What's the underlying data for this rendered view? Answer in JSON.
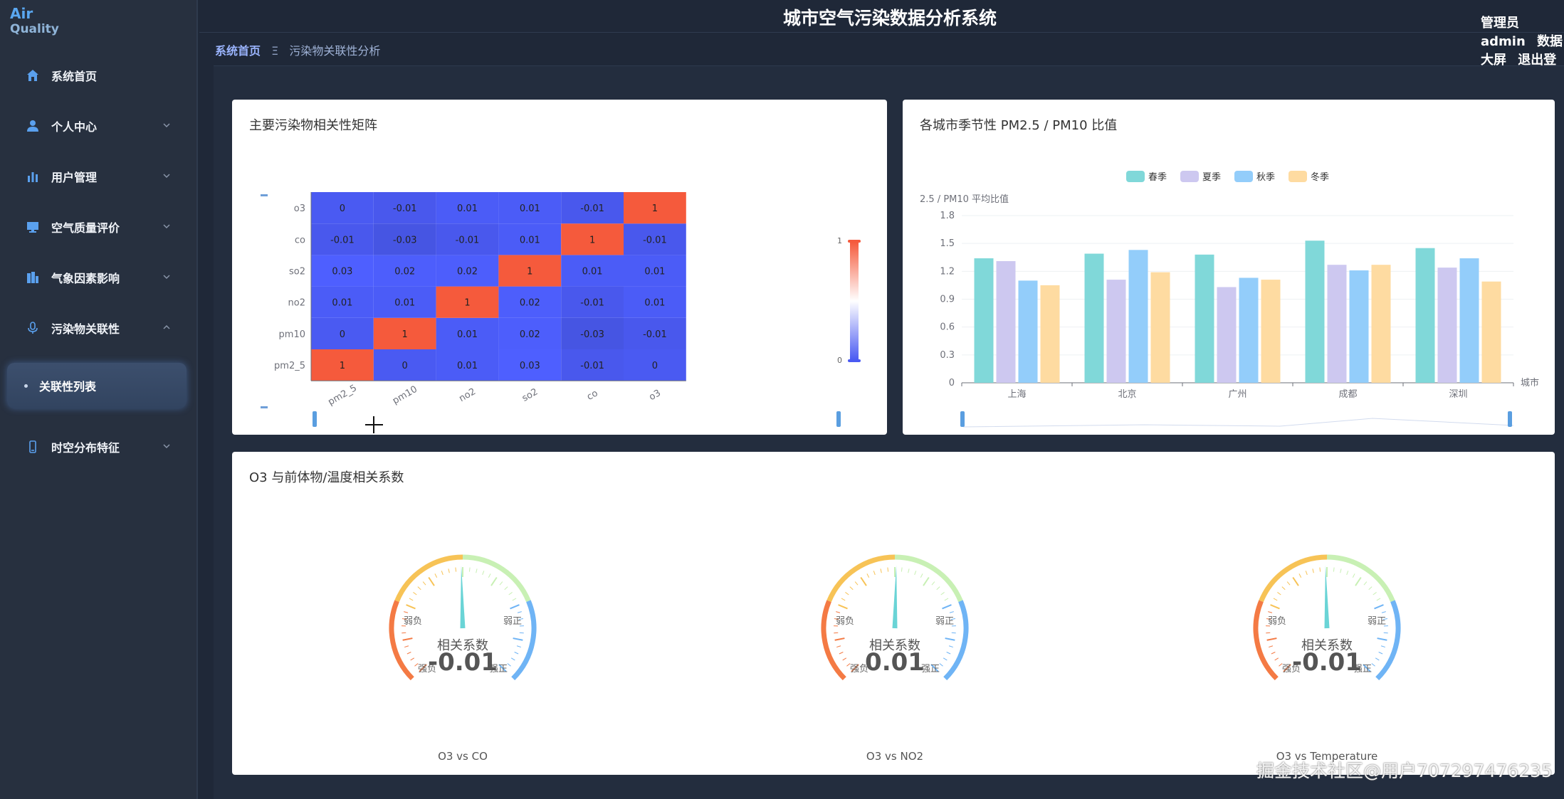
{
  "app": {
    "logo_line1": "Air",
    "logo_line2": "Quality",
    "title": "城市空气污染数据分析系统",
    "header_links": [
      "管理员 admin",
      "数据大屏",
      "退出登录"
    ]
  },
  "breadcrumb": {
    "home": "系统首页",
    "separator": "Ξ",
    "current": "污染物关联性分析"
  },
  "sidebar": {
    "items": [
      {
        "label": "系统首页",
        "icon": "home-icon",
        "expandable": false
      },
      {
        "label": "个人中心",
        "icon": "user-icon",
        "expandable": true
      },
      {
        "label": "用户管理",
        "icon": "bar-chart-icon",
        "expandable": true
      },
      {
        "label": "空气质量评价",
        "icon": "monitor-icon",
        "expandable": true
      },
      {
        "label": "气象因素影响",
        "icon": "building-icon",
        "expandable": true
      },
      {
        "label": "污染物关联性",
        "icon": "microphone-icon",
        "expandable": true,
        "expanded": true
      },
      {
        "label": "时空分布特征",
        "icon": "phone-icon",
        "expandable": true
      }
    ],
    "active_sub": "关联性列表"
  },
  "heatmap_card": {
    "title": "主要污染物相关性矩阵"
  },
  "bar_card": {
    "title": "各城市季节性 PM2.5 / PM10 比值"
  },
  "gauge_card": {
    "title": "O3 与前体物/温度相关系数"
  },
  "colors": {
    "positive": "#f55a3c",
    "negative": "#4a5af2",
    "spring": "#80d8d9",
    "summer": "#cdc8f0",
    "autumn": "#93cdfa",
    "winter": "#fedba1"
  },
  "chart_data": [
    {
      "type": "heatmap",
      "title": "主要污染物相关性矩阵",
      "x_categories": [
        "pm2_5",
        "pm10",
        "no2",
        "so2",
        "co",
        "o3"
      ],
      "y_categories": [
        "pm2_5",
        "pm10",
        "no2",
        "so2",
        "co",
        "o3"
      ],
      "values": [
        [
          1,
          0,
          0.01,
          0.03,
          -0.01,
          0
        ],
        [
          0,
          1,
          0.01,
          0.02,
          -0.03,
          -0.01
        ],
        [
          0.01,
          0.01,
          1,
          0.02,
          -0.01,
          0.01
        ],
        [
          0.03,
          0.02,
          0.02,
          1,
          0.01,
          0.01
        ],
        [
          -0.01,
          -0.03,
          -0.01,
          0.01,
          1,
          -0.01
        ],
        [
          0,
          -0.01,
          0.01,
          0.01,
          -0.01,
          1
        ]
      ],
      "visual_map": {
        "min": 0,
        "max": 1
      }
    },
    {
      "type": "bar",
      "title": "各城市季节性 PM2.5 / PM10 比值",
      "categories": [
        "上海",
        "北京",
        "广州",
        "成都",
        "深圳"
      ],
      "xlabel": "城市",
      "ylabel": "2.5 / PM10 平均比值",
      "ylim": [
        0,
        1.8
      ],
      "yticks": [
        0,
        0.3,
        0.6,
        0.9,
        1.2,
        1.5,
        1.8
      ],
      "legend_position": "top",
      "series": [
        {
          "name": "春季",
          "values": [
            1.34,
            1.39,
            1.38,
            1.53,
            1.45
          ]
        },
        {
          "name": "夏季",
          "values": [
            1.31,
            1.11,
            1.03,
            1.27,
            1.24
          ]
        },
        {
          "name": "秋季",
          "values": [
            1.1,
            1.43,
            1.13,
            1.21,
            1.34
          ]
        },
        {
          "name": "冬季",
          "values": [
            1.05,
            1.19,
            1.11,
            1.27,
            1.09
          ]
        }
      ]
    },
    {
      "type": "gauge",
      "title": "O3 与前体物/温度相关系数",
      "range": [
        -1,
        1
      ],
      "center_label": "相关系数",
      "zone_labels": [
        "强负",
        "弱负",
        "弱正",
        "强正"
      ],
      "gauges": [
        {
          "name": "O3 vs CO",
          "value": -0.01
        },
        {
          "name": "O3 vs NO2",
          "value": 0.01
        },
        {
          "name": "O3 vs Temperature",
          "value": -0.01
        }
      ]
    }
  ],
  "watermark": "掘金技术社区@用户707297476235"
}
